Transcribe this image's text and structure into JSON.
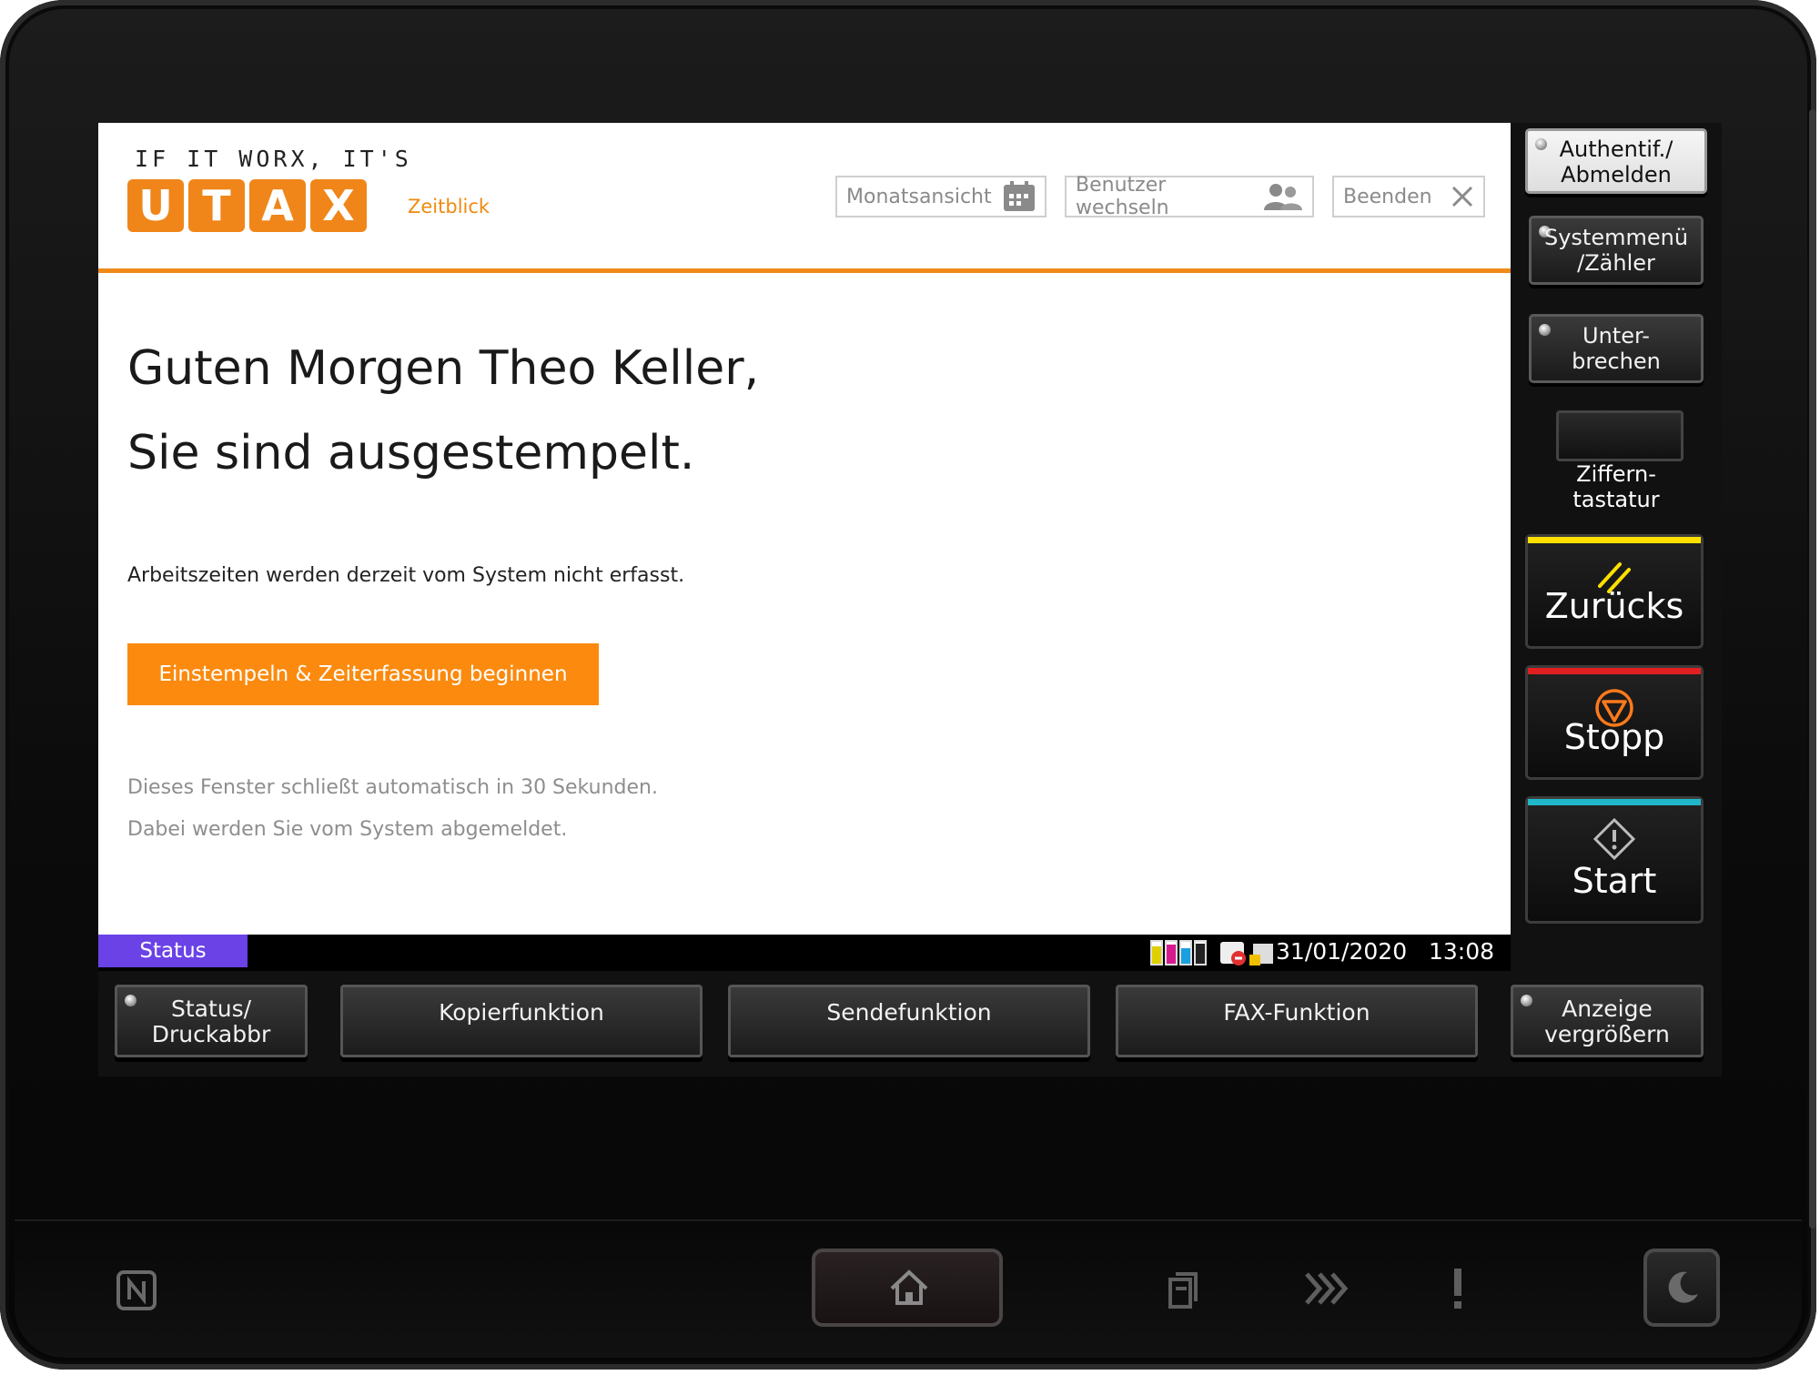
{
  "app": {
    "tagline": "IF IT WORX, IT'S",
    "logo_letters": [
      "U",
      "T",
      "A",
      "X"
    ],
    "name": "Zeitblick",
    "accent_color": "#f08a1a"
  },
  "toolbar": {
    "month_view": "Monatsansicht",
    "switch_user": "Benutzer wechseln",
    "quit": "Beenden"
  },
  "main": {
    "greeting_line1": "Guten Morgen Theo Keller,",
    "greeting_line2": "Sie sind ausgestempelt.",
    "info": "Arbeitszeiten werden derzeit vom System nicht erfasst.",
    "cta": "Einstempeln & Zeiterfassung beginnen",
    "note_line1": "Dieses Fenster schließt automatisch in 30 Sekunden.",
    "note_line2": "Dabei werden Sie vom System abgemeldet."
  },
  "statusbar": {
    "status_label": "Status",
    "date": "31/01/2020",
    "time": "13:08"
  },
  "side": {
    "auth_line1": "Authentif./",
    "auth_line2": "Abmelden",
    "sysmenu_line1": "Systemmenü",
    "sysmenu_line2": "/Zähler",
    "interrupt_line1": "Unter-",
    "interrupt_line2": "brechen",
    "keypad_line1": "Ziffern-",
    "keypad_line2": "tastatur",
    "reset": "Zurücks",
    "stop": "Stopp",
    "start": "Start"
  },
  "function_bar": {
    "status_line1": "Status/",
    "status_line2": "Druckabbr",
    "copy": "Kopierfunktion",
    "send": "Sendefunktion",
    "fax": "FAX-Funktion",
    "zoom_line1": "Anzeige",
    "zoom_line2": "vergrößern"
  },
  "icons": {
    "month_view": "calendar-icon",
    "switch_user": "users-icon",
    "quit": "close-icon",
    "reset": "reset-icon",
    "stop": "stop-icon",
    "start": "start-icon",
    "nfc": "nfc-icon",
    "home": "home-icon",
    "document_box": "document-box-icon",
    "processing": "processing-icon",
    "attention": "attention-icon",
    "energy_saver": "energy-saver-icon"
  }
}
